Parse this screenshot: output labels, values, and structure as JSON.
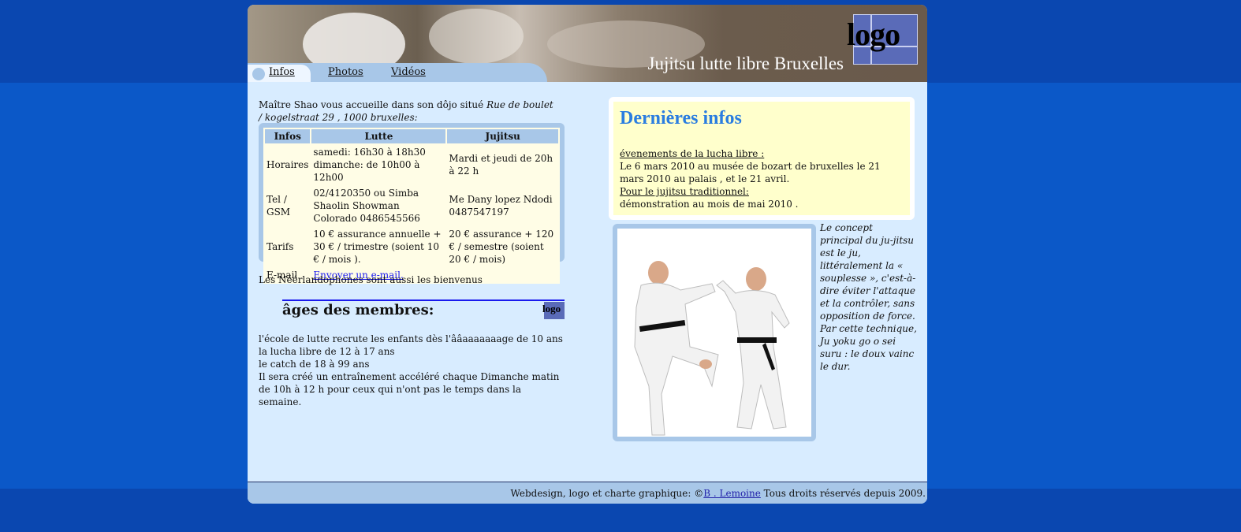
{
  "header": {
    "site_title": "Jujitsu lutte libre Bruxelles",
    "logo_text": "logo"
  },
  "nav": {
    "items": [
      {
        "label": "Infos"
      },
      {
        "label": "Photos"
      },
      {
        "label": "Vidéos"
      }
    ]
  },
  "intro": {
    "text": " Maître Shao vous accueille dans son dôjo situé ",
    "address": "Rue de boulet / kogelstraat 29 , 1000 bruxelles:"
  },
  "table": {
    "headers": [
      "Infos",
      "Lutte",
      "Jujitsu"
    ],
    "rows": [
      {
        "label": "Horaires",
        "lutte": "samedi: 16h30 à 18h30 dimanche: de 10h00 à 12h00",
        "jujitsu": "Mardi et jeudi de 20h à 22 h"
      },
      {
        "label": "Tel / GSM",
        "lutte": "02/4120350 ou Simba Shaolin Showman Colorado 0486545566",
        "jujitsu": "Me Dany lopez Ndodi 0487547197"
      },
      {
        "label": "Tarifs",
        "lutte": "10 € assurance annuelle + 30 € / trimestre (soient 10 € / mois ).",
        "jujitsu": "20 € assurance + 120 € / semestre (soient 20 € / mois)"
      },
      {
        "label": "E-mail",
        "lutte": "Envoyer un e-mail.",
        "jujitsu": ""
      }
    ]
  },
  "neerl": "Les Néérlandophones sont aussi les bienvenus",
  "ages": {
    "title": "âges des membres:",
    "logo_text": "logo",
    "lines": [
      "l'école de lutte recrute les enfants dès l'ââaaaaaaage de 10 ans",
      "la lucha libre de 12 à 17 ans",
      "le catch de 18 à 99 ans",
      "Il sera créé un entraînement accéléré chaque Dimanche matin de 10h à 12 h pour ceux qui n'ont pas le temps dans la semaine."
    ]
  },
  "news": {
    "title": "Dernières infos",
    "heading1": "évenements de la lucha libre :",
    "text1": "Le 6 mars 2010 au musée de bozart de bruxelles le 21 mars 2010 au palais , et le 21 avril.",
    "heading2": "Pour le jujitsu traditionnel:",
    "text2": "démonstration au mois de mai 2010 ."
  },
  "concept": "Le concept principal du ju-jitsu est le ju, littéralement la « souplesse », c'est-à-dire éviter l'attaque et la contrôler, sans opposition de force. Par cette technique, Ju yoku go o sei suru : le doux vainc le dur.",
  "footer": {
    "text_before": "Webdesign, logo et charte graphique: ©",
    "author": "B . Lemoine",
    "text_after": " Tous droits réservés depuis 2009."
  },
  "colors": {
    "page_bg": "#0b58c8",
    "content_bg": "#d8ecff",
    "accent_frame": "#a8c7e8",
    "news_title": "#2a7de0",
    "news_bg": "#ffffcc"
  }
}
